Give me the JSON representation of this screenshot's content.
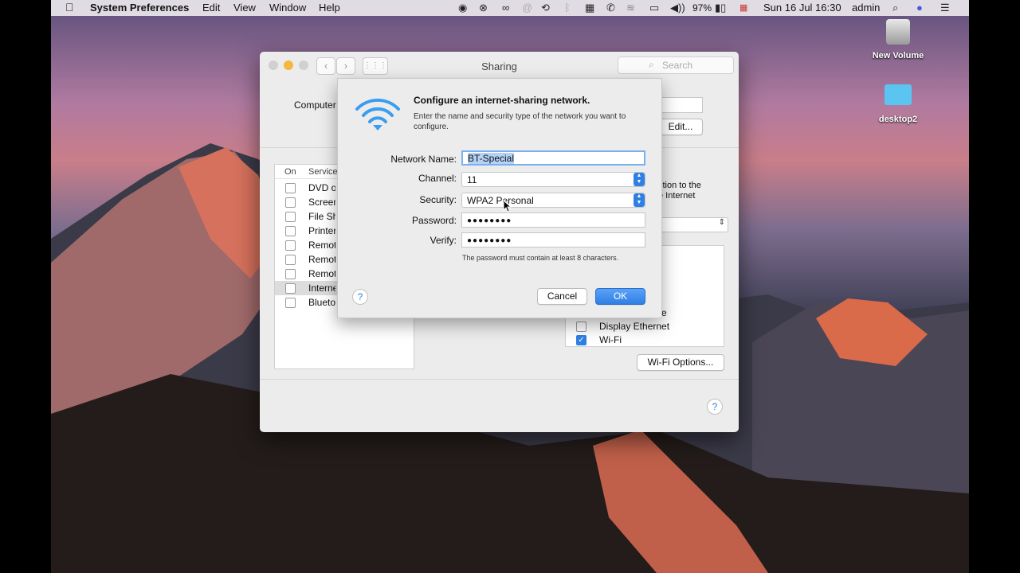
{
  "menubar": {
    "app_name": "System Preferences",
    "menus": [
      "Edit",
      "View",
      "Window",
      "Help"
    ],
    "battery": "97%",
    "datetime": "Sun 16 Jul  16:30",
    "user": "admin"
  },
  "desktop": {
    "icons": [
      {
        "label": "New Volume",
        "icon": "drive-icon"
      },
      {
        "label": "desktop2",
        "icon": "folder-icon"
      }
    ]
  },
  "window": {
    "title": "Sharing",
    "search_placeholder": "Search",
    "computer_name_label": "Computer",
    "edit_button": "Edit...",
    "services_header": {
      "on": "On",
      "service": "Service"
    },
    "services": [
      {
        "label": "DVD or",
        "checked": false
      },
      {
        "label": "Screen",
        "checked": false
      },
      {
        "label": "File Sha",
        "checked": false
      },
      {
        "label": "Printer",
        "checked": false
      },
      {
        "label": "Remote",
        "checked": false
      },
      {
        "label": "Remote",
        "checked": false
      },
      {
        "label": "Remote",
        "checked": false
      },
      {
        "label": "Internet",
        "checked": false
      },
      {
        "label": "Bluetoo",
        "checked": false
      }
    ],
    "desc_line1": "ction to the",
    "desc_line2": "e Internet",
    "ports_partial": "re",
    "ports": [
      {
        "label": "Display Ethernet",
        "checked": false
      },
      {
        "label": "Wi-Fi",
        "checked": true
      }
    ],
    "wifi_options_button": "Wi-Fi Options...",
    "help_glyph": "?"
  },
  "sheet": {
    "title": "Configure an internet-sharing network.",
    "description": "Enter the name and security type of the network you want to configure.",
    "fields": {
      "network_name": {
        "label": "Network Name:",
        "value": "BT-Special"
      },
      "channel": {
        "label": "Channel:",
        "value": "11"
      },
      "security": {
        "label": "Security:",
        "value": "WPA2 Personal"
      },
      "password": {
        "label": "Password:",
        "value": "●●●●●●●●"
      },
      "verify": {
        "label": "Verify:",
        "value": "●●●●●●●●"
      }
    },
    "hint": "The password must contain at least 8 characters.",
    "help_glyph": "?",
    "cancel_button": "Cancel",
    "ok_button": "OK"
  },
  "colors": {
    "accent": "#2f7fe4",
    "wifi_icon": "#3a9df0"
  }
}
